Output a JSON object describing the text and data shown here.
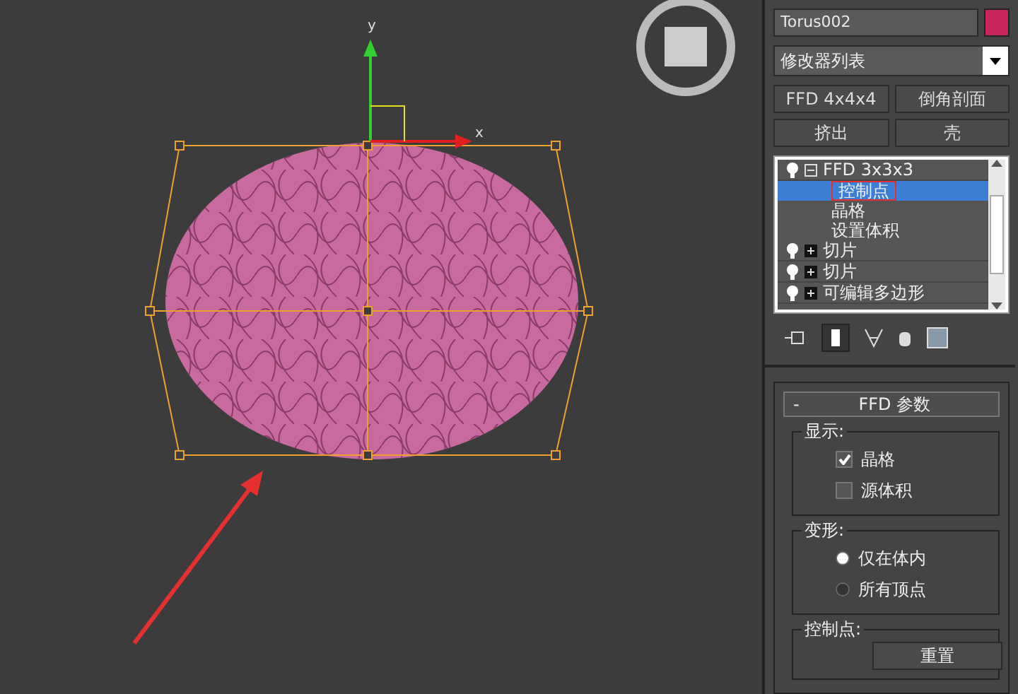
{
  "viewport": {
    "axis_labels": [
      {
        "kind": "y",
        "label": "y"
      },
      {
        "kind": "x",
        "label": "x"
      }
    ]
  },
  "object_name": {
    "value": "Torus002",
    "color": "#c8245e"
  },
  "modifier_list": {
    "value": "修改器列表"
  },
  "modifier_buttons": [
    "FFD 4x4x4",
    "倒角剖面",
    "挤出",
    "壳"
  ],
  "modifier_stack": [
    {
      "label": "FFD 3x3x3",
      "expanded": true,
      "children": [
        {
          "label": "控制点",
          "selected": true,
          "annotated": true
        },
        {
          "label": "晶格",
          "selected": false,
          "annotated": false
        },
        {
          "label": "设置体积",
          "selected": false,
          "annotated": false
        }
      ]
    },
    {
      "label": "切片",
      "expanded": false
    },
    {
      "label": "切片",
      "expanded": false
    },
    {
      "label": "可编辑多边形",
      "expanded": false
    }
  ],
  "rollout": {
    "title": "FFD 参数",
    "toggle": "-",
    "display": {
      "title": "显示:",
      "options": [
        {
          "label": "晶格",
          "checked": true
        },
        {
          "label": "源体积",
          "checked": false
        }
      ]
    },
    "deform": {
      "title": "变形:",
      "options": [
        {
          "label": "仅在体内",
          "selected": true
        },
        {
          "label": "所有顶点",
          "selected": false
        }
      ]
    },
    "control_points": {
      "title": "控制点:",
      "button": "重置"
    }
  }
}
